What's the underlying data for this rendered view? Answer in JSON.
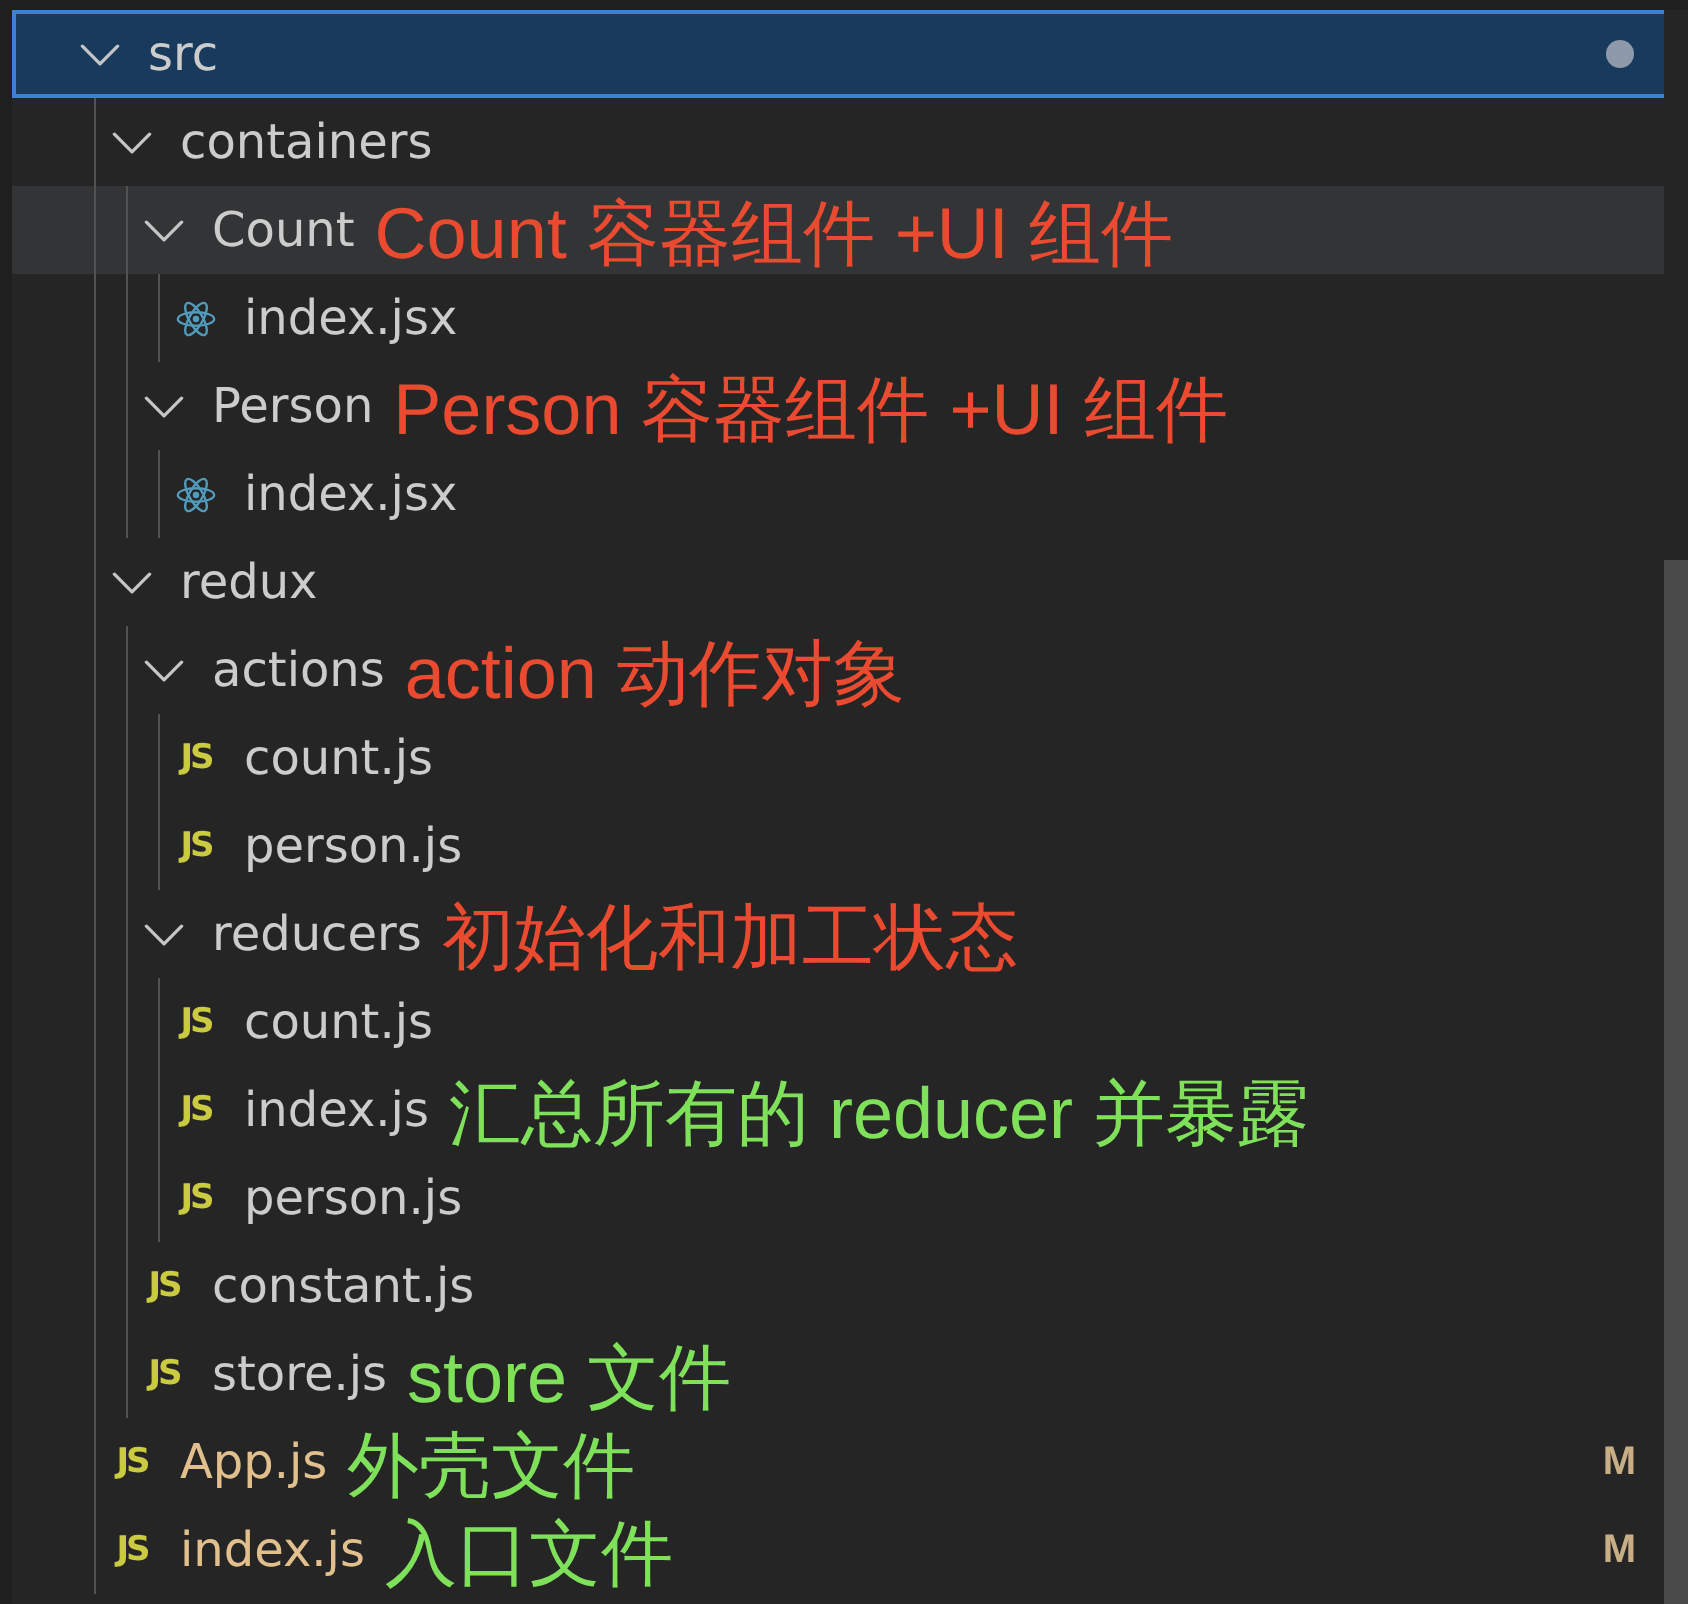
{
  "explorer": {
    "tree": [
      {
        "kind": "folder",
        "name": "src",
        "expanded": true,
        "selected": true,
        "hovered": false,
        "modified": false,
        "has_changes": true,
        "children": [
          {
            "kind": "folder",
            "name": "containers",
            "expanded": true,
            "selected": false,
            "hovered": false,
            "modified": false,
            "has_changes": false,
            "children": [
              {
                "kind": "folder",
                "name": "Count",
                "expanded": true,
                "selected": false,
                "hovered": true,
                "modified": false,
                "has_changes": false,
                "note": {
                  "text": "Count 容器组件 +UI 组件",
                  "color": "#ea4a2f"
                },
                "children": [
                  {
                    "kind": "react",
                    "name": "index.jsx",
                    "selected": false,
                    "hovered": false,
                    "modified": false,
                    "has_changes": false
                  }
                ]
              },
              {
                "kind": "folder",
                "name": "Person",
                "expanded": true,
                "selected": false,
                "hovered": false,
                "modified": false,
                "has_changes": false,
                "note": {
                  "text": "Person 容器组件 +UI 组件",
                  "color": "#ea4a2f"
                },
                "children": [
                  {
                    "kind": "react",
                    "name": "index.jsx",
                    "selected": false,
                    "hovered": false,
                    "modified": false,
                    "has_changes": false
                  }
                ]
              }
            ]
          },
          {
            "kind": "folder",
            "name": "redux",
            "expanded": true,
            "selected": false,
            "hovered": false,
            "modified": false,
            "has_changes": false,
            "children": [
              {
                "kind": "folder",
                "name": "actions",
                "expanded": true,
                "selected": false,
                "hovered": false,
                "modified": false,
                "has_changes": false,
                "note": {
                  "text": "action 动作对象",
                  "color": "#ea4a2f"
                },
                "children": [
                  {
                    "kind": "js",
                    "icon_text": "JS",
                    "name": "count.js",
                    "selected": false,
                    "hovered": false,
                    "modified": false,
                    "has_changes": false
                  },
                  {
                    "kind": "js",
                    "icon_text": "JS",
                    "name": "person.js",
                    "selected": false,
                    "hovered": false,
                    "modified": false,
                    "has_changes": false
                  }
                ]
              },
              {
                "kind": "folder",
                "name": "reducers",
                "expanded": true,
                "selected": false,
                "hovered": false,
                "modified": false,
                "has_changes": false,
                "note": {
                  "text": "初始化和加工状态",
                  "color": "#ea4a2f"
                },
                "children": [
                  {
                    "kind": "js",
                    "icon_text": "JS",
                    "name": "count.js",
                    "selected": false,
                    "hovered": false,
                    "modified": false,
                    "has_changes": false
                  },
                  {
                    "kind": "js",
                    "icon_text": "JS",
                    "name": "index.js",
                    "selected": false,
                    "hovered": false,
                    "modified": false,
                    "has_changes": false,
                    "note": {
                      "text": "汇总所有的 reducer 并暴露",
                      "color": "#7fe05a"
                    }
                  },
                  {
                    "kind": "js",
                    "icon_text": "JS",
                    "name": "person.js",
                    "selected": false,
                    "hovered": false,
                    "modified": false,
                    "has_changes": false
                  }
                ]
              },
              {
                "kind": "js",
                "icon_text": "JS",
                "name": "constant.js",
                "selected": false,
                "hovered": false,
                "modified": false,
                "has_changes": false
              },
              {
                "kind": "js",
                "icon_text": "JS",
                "name": "store.js",
                "selected": false,
                "hovered": false,
                "modified": false,
                "has_changes": false,
                "note": {
                  "text": "store 文件",
                  "color": "#7fe05a"
                }
              }
            ]
          },
          {
            "kind": "js",
            "icon_text": "JS",
            "name": "App.js",
            "selected": false,
            "hovered": false,
            "modified": true,
            "has_changes": false,
            "badge": "M",
            "note": {
              "text": "外壳文件",
              "color": "#7fe05a"
            }
          },
          {
            "kind": "js",
            "icon_text": "JS",
            "name": "index.js",
            "selected": false,
            "hovered": false,
            "modified": true,
            "has_changes": false,
            "badge": "M",
            "note": {
              "text": "入口文件",
              "color": "#7fe05a"
            }
          }
        ]
      }
    ]
  }
}
